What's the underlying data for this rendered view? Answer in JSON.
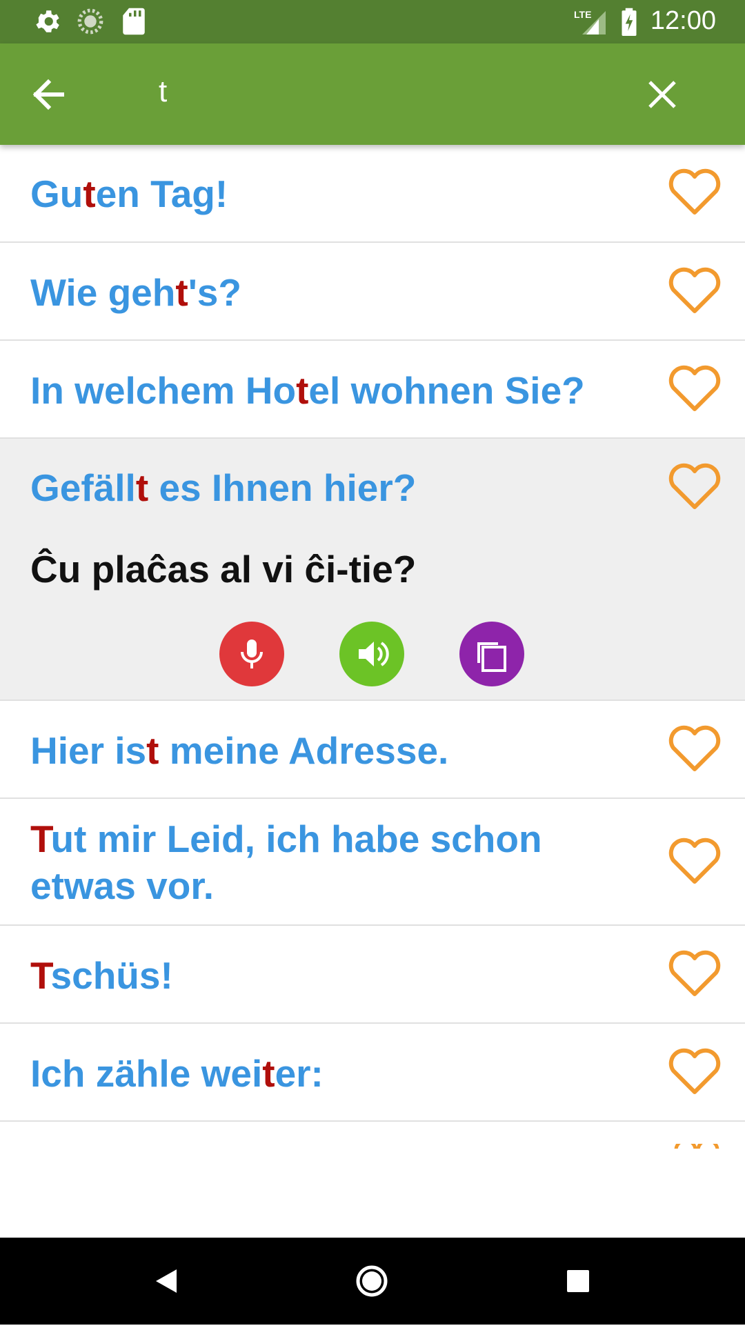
{
  "status_bar": {
    "time": "12:00",
    "network_label": "LTE",
    "icons": [
      "settings-icon",
      "sync-icon",
      "sd-card-icon",
      "signal-icon",
      "battery-charging-icon"
    ]
  },
  "toolbar": {
    "query": "t",
    "icons": [
      "back-arrow-icon",
      "close-icon"
    ]
  },
  "colors": {
    "status_bar": "#548031",
    "toolbar": "#6a9f38",
    "phrase_text": "#3a95e0",
    "highlight": "#b00f0b",
    "heart": "#f29a2e",
    "mic_button": "#e0383b",
    "speaker_button": "#6cc326",
    "copy_button": "#8e24aa",
    "expanded_row": "#efefef"
  },
  "phrases": [
    {
      "before": "Gu",
      "match": "t",
      "after": "en Tag!"
    },
    {
      "before": "Wie geh",
      "match": "t",
      "after": "'s?"
    },
    {
      "before": "In welchem Ho",
      "match": "t",
      "after": "el wohnen Sie?"
    },
    {
      "before": "Gefäll",
      "match": "t",
      "after": " es Ihnen hier?",
      "translation": "Ĉu plaĉas al vi ĉi-tie?"
    },
    {
      "before": "Hier is",
      "match": "t",
      "after": " meine Adresse."
    },
    {
      "before": "",
      "match": "T",
      "after": "ut mir Leid, ich habe schon",
      "after2": "etwas vor."
    },
    {
      "before": "",
      "match": "T",
      "after": "schüs!"
    },
    {
      "before": "Ich zähle wei",
      "match": "t",
      "after": "er:"
    }
  ],
  "actions": [
    "microphone-icon",
    "speaker-icon",
    "copy-icon"
  ],
  "nav": [
    "back-triangle-icon",
    "home-circle-icon",
    "recents-square-icon"
  ]
}
